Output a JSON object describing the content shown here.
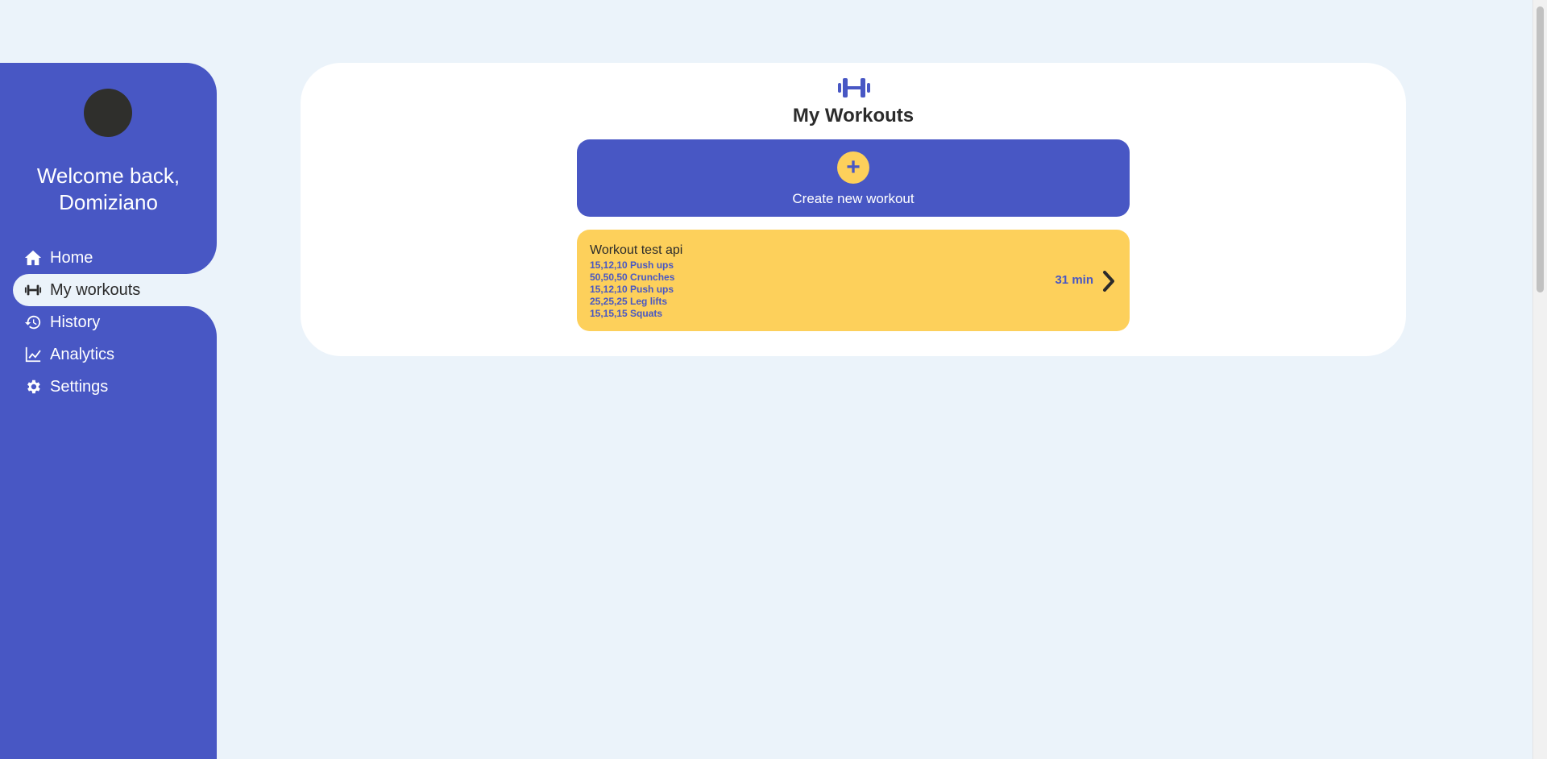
{
  "sidebar": {
    "welcome_line1": "Welcome back,",
    "welcome_line2": "Domiziano",
    "items": [
      {
        "label": "Home",
        "icon": "home-icon"
      },
      {
        "label": "My workouts",
        "icon": "dumbbell-icon",
        "active": true
      },
      {
        "label": "History",
        "icon": "history-icon"
      },
      {
        "label": "Analytics",
        "icon": "chart-line-icon"
      },
      {
        "label": "Settings",
        "icon": "gear-icon"
      }
    ]
  },
  "main": {
    "title": "My Workouts",
    "create_label": "Create new workout",
    "create_icon": "plus-icon",
    "workouts": [
      {
        "name": "Workout test api",
        "exercises": [
          "15,12,10 Push ups",
          "50,50,50 Crunches",
          "15,12,10 Push ups",
          "25,25,25 Leg lifts",
          "15,15,15 Squats"
        ],
        "duration": "31 min"
      }
    ]
  },
  "colors": {
    "primary": "#4857c4",
    "accent": "#fdd05b",
    "background": "#ebf3fa",
    "card": "#ffffff",
    "text": "#2b2b2b"
  }
}
